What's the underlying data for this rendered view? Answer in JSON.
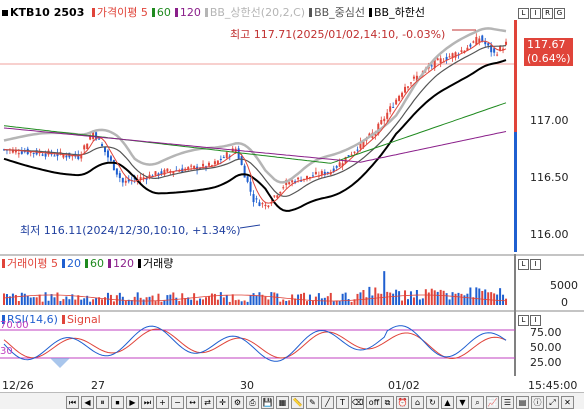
{
  "header": {
    "symbol": "KTB10",
    "contract": "2503",
    "legend": [
      {
        "label": "가격이평",
        "value": "5",
        "color": "#e0443a"
      },
      {
        "label": "60",
        "color": "#1f8a1f"
      },
      {
        "label": "120",
        "color": "#8a1f8a"
      },
      {
        "label": "BB_상한선(20,2,C)",
        "color": "#b5b5b5"
      },
      {
        "label": "BB_중심선",
        "color": "#555555"
      },
      {
        "label": "BB_하한선",
        "color": "#000000"
      }
    ],
    "pane_buttons": [
      "L",
      "I",
      "R",
      "G"
    ]
  },
  "annotations": {
    "high_label": "최고 117.71(2025/01/02,14:10, -0.03%)",
    "low_label": "최저 116.11(2024/12/30,10:10, +1.34%)"
  },
  "price_axis": {
    "ticks": [
      "117.00",
      "116.50",
      "116.00"
    ],
    "current_price": "117.67",
    "current_change": "(0.64%)"
  },
  "volume_pane": {
    "legend": [
      {
        "label": "거래이평",
        "value": "5",
        "color": "#e0443a"
      },
      {
        "label": "20",
        "color": "#1f5fd0"
      },
      {
        "label": "60",
        "color": "#1f8a1f"
      },
      {
        "label": "120",
        "color": "#8a1f8a"
      },
      {
        "label": "거래량",
        "color": "#000000"
      }
    ],
    "ticks": [
      "5000",
      "0"
    ],
    "buttons": [
      "L",
      "I"
    ]
  },
  "rsi_pane": {
    "legend": [
      {
        "label": "RSI(14,6)",
        "color": "#1f5fd0"
      },
      {
        "label": "Signal",
        "color": "#e0443a"
      }
    ],
    "left_ticks": [
      "70.00",
      "30"
    ],
    "ticks": [
      "75.00",
      "50.00",
      "25.00"
    ],
    "buttons": [
      "L",
      "I"
    ]
  },
  "time_axis": {
    "labels": [
      "12/26",
      "27",
      "30",
      "01/02"
    ],
    "last_time": "15:45:00"
  },
  "colors": {
    "up": "#e0443a",
    "down": "#1f5fd0",
    "bb_upper": "#b5b5b5",
    "bb_mid": "#555555",
    "bb_lower": "#000000",
    "ma60": "#1f8a1f",
    "ma120": "#8a1f8a",
    "rsi_band": "#c040c0"
  },
  "toolbar": {
    "buttons": [
      "first-icon",
      "prev-icon",
      "pause-icon",
      "stop-icon",
      "next-icon",
      "last-icon",
      "zoom-in-icon",
      "zoom-out-icon",
      "fit-icon",
      "scroll-icon",
      "crosshair-icon",
      "settings-icon",
      "print-icon",
      "save-icon",
      "grid-icon",
      "ruler-icon",
      "draw-icon",
      "trend-icon",
      "text-icon",
      "erase-icon",
      "off-icon",
      "copy-icon",
      "alarm-icon",
      "home-icon",
      "refresh-icon",
      "up-icon",
      "down-icon",
      "search-icon",
      "chart-icon",
      "list-icon",
      "table-icon",
      "info-icon",
      "expand-icon",
      "close-icon"
    ],
    "off_label": "off"
  }
}
